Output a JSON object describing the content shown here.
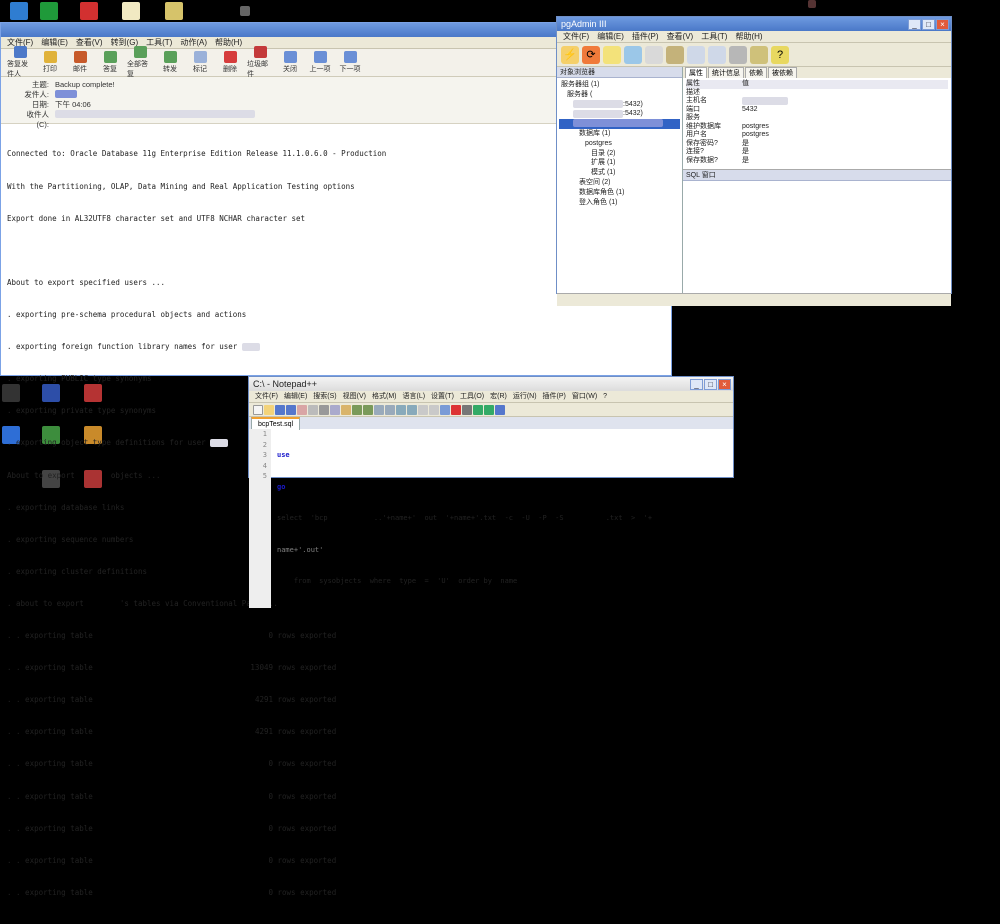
{
  "desktop": {
    "icons_top": [
      "app-icon",
      "app-icon",
      "app-icon",
      "folder-icon",
      "app-icon"
    ],
    "icons_bottom": [
      "app-icon",
      "app-icon",
      "app-icon",
      "app-icon",
      "app-icon",
      "app-icon",
      "app-icon",
      "app-icon"
    ]
  },
  "email": {
    "menu": [
      "文件(F)",
      "编辑(E)",
      "查看(V)",
      "转到(G)",
      "工具(T)",
      "动作(A)",
      "帮助(H)"
    ],
    "toolbar": [
      "答复发件人",
      "打印",
      "邮件",
      "答复",
      "全部答复",
      "转发",
      "标记",
      "删除",
      "垃圾邮件",
      "关闭",
      "上一项",
      "下一项"
    ],
    "header": {
      "subject_label": "主题:",
      "subject": "Backup complete!",
      "from_label": "发件人:",
      "date_label": "日期:",
      "date": "下午 04:06",
      "to_label": "收件人(C):"
    },
    "console_lines": [
      "Connected to: Oracle Database 11g Enterprise Edition Release 11.1.0.6.0 - Production",
      "With the Partitioning, OLAP, Data Mining and Real Application Testing options",
      "Export done in AL32UTF8 character set and UTF8 NCHAR character set",
      "",
      "About to export specified users ...",
      ". exporting pre-schema procedural objects and actions",
      ". exporting foreign function library names for user",
      ". exporting PUBLIC type synonyms",
      ". exporting private type synonyms",
      ". exporting object type definitions for user",
      "About to export        objects ...",
      ". exporting database links",
      ". exporting sequence numbers",
      ". exporting cluster definitions",
      ". about to export        's tables via Conventional Path ..."
    ],
    "table_rows": [
      {
        "label": ". . exporting table",
        "count": "0",
        "suffix": "rows exported"
      },
      {
        "label": ". . exporting table",
        "count": "13049",
        "suffix": "rows exported"
      },
      {
        "label": ". . exporting table",
        "count": "4291",
        "suffix": "rows exported"
      },
      {
        "label": ". . exporting table",
        "count": "4291",
        "suffix": "rows exported"
      },
      {
        "label": ". . exporting table",
        "count": "0",
        "suffix": "rows exported"
      },
      {
        "label": ". . exporting table",
        "count": "0",
        "suffix": "rows exported"
      },
      {
        "label": ". . exporting table",
        "count": "0",
        "suffix": "rows exported"
      },
      {
        "label": ". . exporting table",
        "count": "0",
        "suffix": "rows exported"
      },
      {
        "label": ". . exporting table",
        "count": "0",
        "suffix": "rows exported"
      }
    ]
  },
  "pgadmin": {
    "title": "pgAdmin III",
    "menu": [
      "文件(F)",
      "编辑(E)",
      "插件(P)",
      "查看(V)",
      "工具(T)",
      "帮助(H)"
    ],
    "tree_title": "对象浏览器",
    "tree": [
      {
        "text": "服务器组 (1)",
        "indent": 0
      },
      {
        "text": "服务器 (",
        "indent": 1
      },
      {
        "text": ":5432)",
        "indent": 2
      },
      {
        "text": ":5432)",
        "indent": 2
      },
      {
        "text": "数据库 (1)",
        "indent": 3
      },
      {
        "text": "postgres",
        "indent": 4
      },
      {
        "text": "目录 (2)",
        "indent": 5
      },
      {
        "text": "扩展 (1)",
        "indent": 5
      },
      {
        "text": "模式 (1)",
        "indent": 5
      },
      {
        "text": "表空间 (2)",
        "indent": 3
      },
      {
        "text": "数据库角色 (1)",
        "indent": 3
      },
      {
        "text": "登入角色 (1)",
        "indent": 3
      }
    ],
    "tabs": [
      "属性",
      "统计信息",
      "依赖",
      "被依赖"
    ],
    "props_header": [
      "属性",
      "值"
    ],
    "props": [
      {
        "k": "描述",
        "v": ""
      },
      {
        "k": "主机名",
        "v": ""
      },
      {
        "k": "端口",
        "v": "5432"
      },
      {
        "k": "服务",
        "v": ""
      },
      {
        "k": "维护数据库",
        "v": "postgres"
      },
      {
        "k": "用户名",
        "v": "postgres"
      },
      {
        "k": "保存密码?",
        "v": "是"
      },
      {
        "k": "连接?",
        "v": "是"
      },
      {
        "k": "保存数据?",
        "v": "是"
      }
    ],
    "sql_title": "SQL 窗口"
  },
  "notepad": {
    "title": "C:\\                                 - Notepad++",
    "menu": [
      "文件(F)",
      "编辑(E)",
      "搜索(S)",
      "视图(V)",
      "格式(M)",
      "语言(L)",
      "设置(T)",
      "工具(O)",
      "宏(R)",
      "运行(N)",
      "插件(P)",
      "窗口(W)",
      "?"
    ],
    "tab": "bcpTest.sql",
    "lines": [
      {
        "n": "1",
        "code": "use        "
      },
      {
        "n": "2",
        "code": "go"
      },
      {
        "n": "3",
        "code": "select  'bcp           ..'+name+'  out  '+name+'.txt  -c  -U  -P  -S          .txt  >  '+"
      },
      {
        "n": "4",
        "code": "name+'.out'"
      },
      {
        "n": "5",
        "code": "    from  sysobjects  where  type  =  'U'  order by  name"
      }
    ]
  },
  "colors": {
    "titlebar": "#4a78c8",
    "desktop": "#000000"
  }
}
